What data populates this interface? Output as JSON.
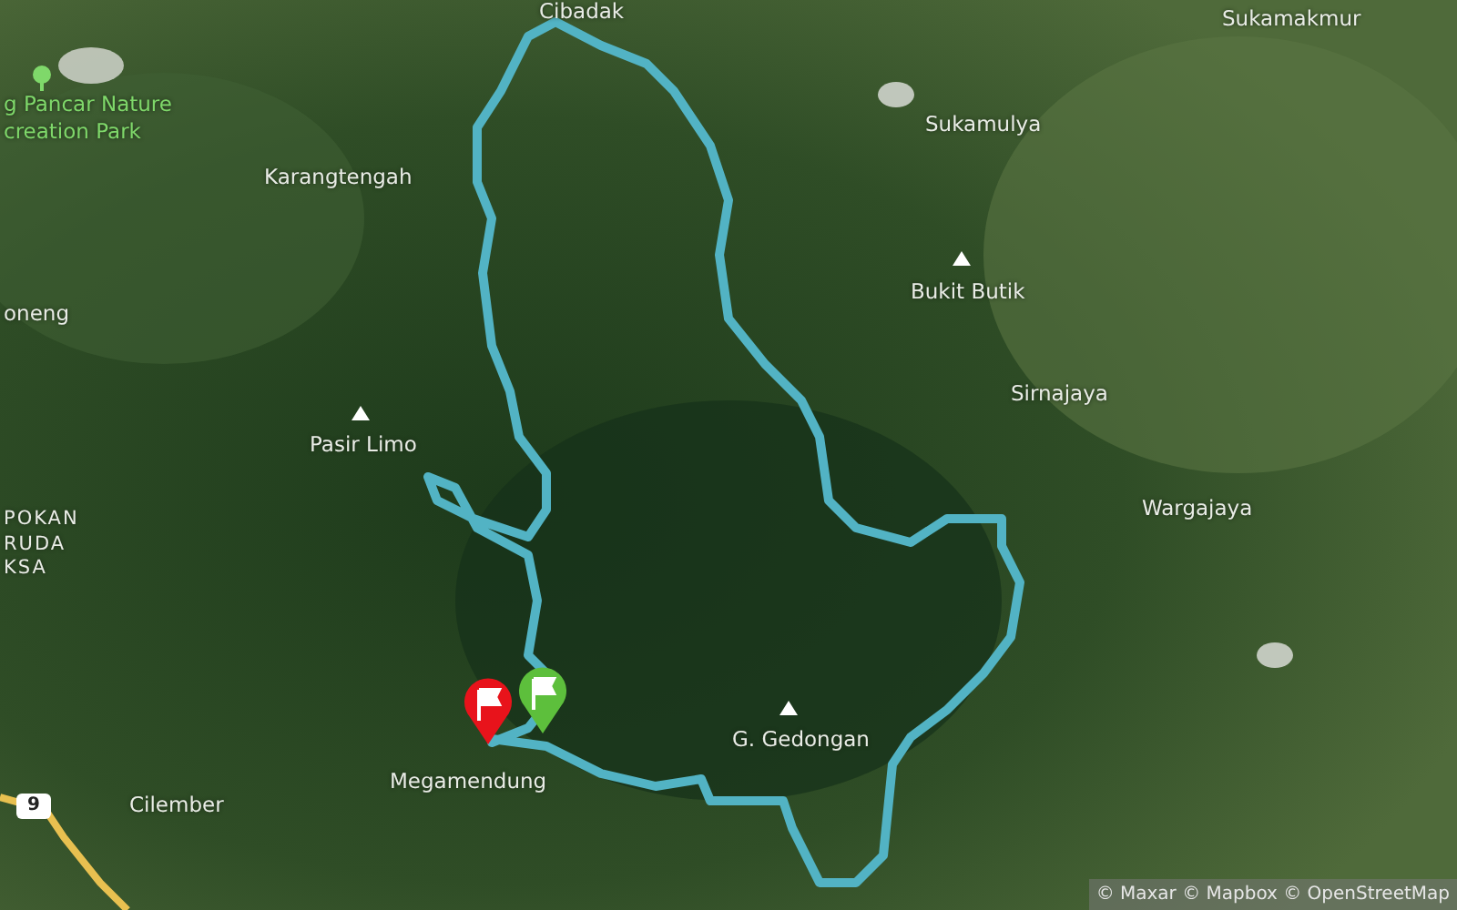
{
  "map": {
    "places": [
      {
        "kind": "town",
        "label": "Cibadak"
      },
      {
        "kind": "town",
        "label": "Sukamakmur"
      },
      {
        "kind": "park",
        "label": "g Pancar Nature"
      },
      {
        "kind": "park",
        "label": "creation Park"
      },
      {
        "kind": "town",
        "label": "Sukamulya"
      },
      {
        "kind": "town",
        "label": "Karangtengah"
      },
      {
        "kind": "peak",
        "label": "Bukit Butik"
      },
      {
        "kind": "town",
        "label": "oneng"
      },
      {
        "kind": "town",
        "label": "Sirnajaya"
      },
      {
        "kind": "peak",
        "label": "Pasir Limo"
      },
      {
        "kind": "town",
        "label": "Wargajaya"
      },
      {
        "kind": "area",
        "label": "POKAN"
      },
      {
        "kind": "area",
        "label": "RUDA"
      },
      {
        "kind": "area",
        "label": "KSA"
      },
      {
        "kind": "peak",
        "label": "G. Gedongan"
      },
      {
        "kind": "town",
        "label": "Megamendung"
      },
      {
        "kind": "town",
        "label": "Cilember"
      }
    ],
    "road_shield": "9",
    "markers": [
      {
        "kind": "end",
        "color": "#e8131b"
      },
      {
        "kind": "start",
        "color": "#5dbf3c"
      }
    ],
    "attribution": "© Maxar © Mapbox © OpenStreetMap"
  }
}
